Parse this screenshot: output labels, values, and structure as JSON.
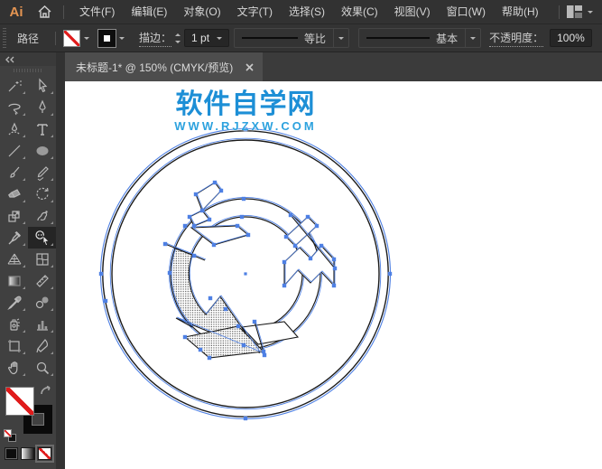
{
  "app": {
    "logo_text": "Ai",
    "logo_color": "#e59552"
  },
  "menubar": {
    "items": [
      "文件(F)",
      "编辑(E)",
      "对象(O)",
      "文字(T)",
      "选择(S)",
      "效果(C)",
      "视图(V)",
      "窗口(W)",
      "帮助(H)"
    ]
  },
  "controlbar": {
    "selection_label": "路径",
    "fill_swatch": "none-fill",
    "stroke_swatch": "black-stroke",
    "stroke_label": "描边：",
    "stroke_weight": "1 pt",
    "profile_label": "等比",
    "brush_label": "基本",
    "opacity_label": "不透明度：",
    "opacity_value": "100%"
  },
  "tabbar": {
    "title": "未标题-1* @ 150% (CMYK/预览)"
  },
  "toolbar": {
    "tools": [
      "magic-wand-tool",
      "direct-selection-tool",
      "lasso-tool",
      "pen-tool",
      "curvature-tool",
      "type-tool",
      "line-segment-tool",
      "ellipse-tool",
      "paintbrush-tool",
      "shaper-tool",
      "eraser-tool",
      "rotate-tool",
      "scale-tool",
      "puppet-warp-tool",
      "pin-tool",
      "shape-builder-tool",
      "perspective-grid-tool",
      "mesh-tool",
      "gradient-tool",
      "measure-tool",
      "eyedropper-tool",
      "blend-tool",
      "symbol-sprayer-tool",
      "column-graph-tool",
      "artboard-tool",
      "slice-tool",
      "hand-tool",
      "zoom-tool"
    ],
    "selected_tool": "shape-builder-tool",
    "fill": "none",
    "stroke": "black"
  },
  "canvas": {
    "watermark_title": "软件自学网",
    "watermark_url": "WWW.RJZXW.COM",
    "artwork": "selected circular recycle-arrows path with anchor points",
    "selection_color": "#4e80e4"
  }
}
